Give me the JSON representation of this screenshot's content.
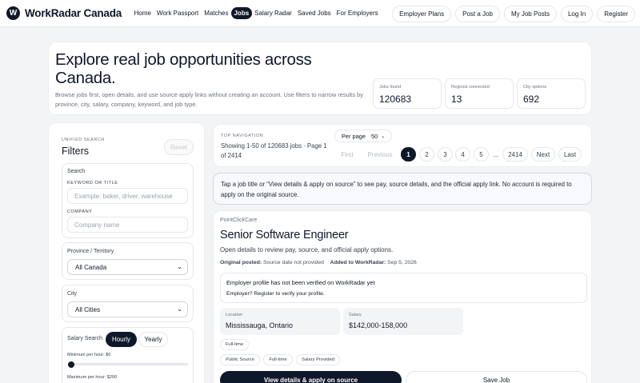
{
  "brand": {
    "logo_letter": "W",
    "name": "WorkRadar Canada"
  },
  "nav": {
    "items": [
      {
        "label": "Home"
      },
      {
        "label": "Work Passport"
      },
      {
        "label": "Matches"
      },
      {
        "label": "Jobs",
        "active": true
      },
      {
        "label": "Salary Radar"
      },
      {
        "label": "Saved Jobs"
      },
      {
        "label": "For Employers"
      }
    ],
    "right": [
      "Employer Plans",
      "Post a Job",
      "My Job Posts",
      "Log In",
      "Register"
    ]
  },
  "hero": {
    "title": "Explore real job opportunities across Canada.",
    "subtitle": "Browse jobs first, open details, and use source apply links without creating an account. Use filters to narrow results by province, city, salary, company, keyword, and job type.",
    "stats": [
      {
        "label": "Jobs found",
        "value": "120683"
      },
      {
        "label": "Regions connected",
        "value": "13"
      },
      {
        "label": "City options",
        "value": "692"
      }
    ]
  },
  "filters": {
    "eyebrow": "UNIFIED SEARCH",
    "title": "Filters",
    "reset_label": "Reset",
    "search_title": "Search",
    "keyword_label": "KEYWORD OR TITLE",
    "keyword_placeholder": "Example: baker, driver, warehouse",
    "company_label": "COMPANY",
    "company_placeholder": "Company name",
    "province_title": "Province / Territory",
    "province_value": "All Canada",
    "city_title": "City",
    "city_value": "All Cities",
    "salary_title": "Salary Search",
    "salary_modes": [
      "Hourly",
      "Yearly"
    ],
    "salary_active": "Hourly",
    "min_label": "Minimum per hour: $0",
    "max_label": "Maximum per hour: $200",
    "min_fraction": 0
  },
  "pagination": {
    "eyebrow": "TOP NAVIGATION",
    "summary": "Showing 1-50 of 120683 jobs · Page 1 of 2414",
    "per_page_label": "Per page",
    "per_page_value": "50",
    "first": "First",
    "previous": "Previous",
    "pages": [
      "1",
      "2",
      "3",
      "4",
      "5"
    ],
    "current": "1",
    "ellipsis": "...",
    "last_page": "2414",
    "next": "Next",
    "last": "Last"
  },
  "notice": "Tap a job title or “View details & apply on source” to see pay, source details, and the official apply link. No account is required to apply on the original source.",
  "job": {
    "company": "PointClickCare",
    "title": "Senior Software Engineer",
    "description": "Open details to review pay, source, and official apply options.",
    "posted_label": "Original posted:",
    "posted_value": "Source date not provided",
    "added_label": "Added to WorkRadar:",
    "added_value": "Sep 5, 2026",
    "verify_title": "Employer profile has not been verified on WorkRadar yet",
    "verify_sub": "Employer? Register to verify your profile.",
    "location_label": "Location",
    "location_value": "Mississauga, Ontario",
    "salary_label": "Salary",
    "salary_value": "$142,000-158,000",
    "type_tag": "Full-time",
    "tags": [
      "Public Source",
      "Full-time",
      "Salary Provided"
    ],
    "cta": "View details & apply on source",
    "save": "Save Job"
  }
}
